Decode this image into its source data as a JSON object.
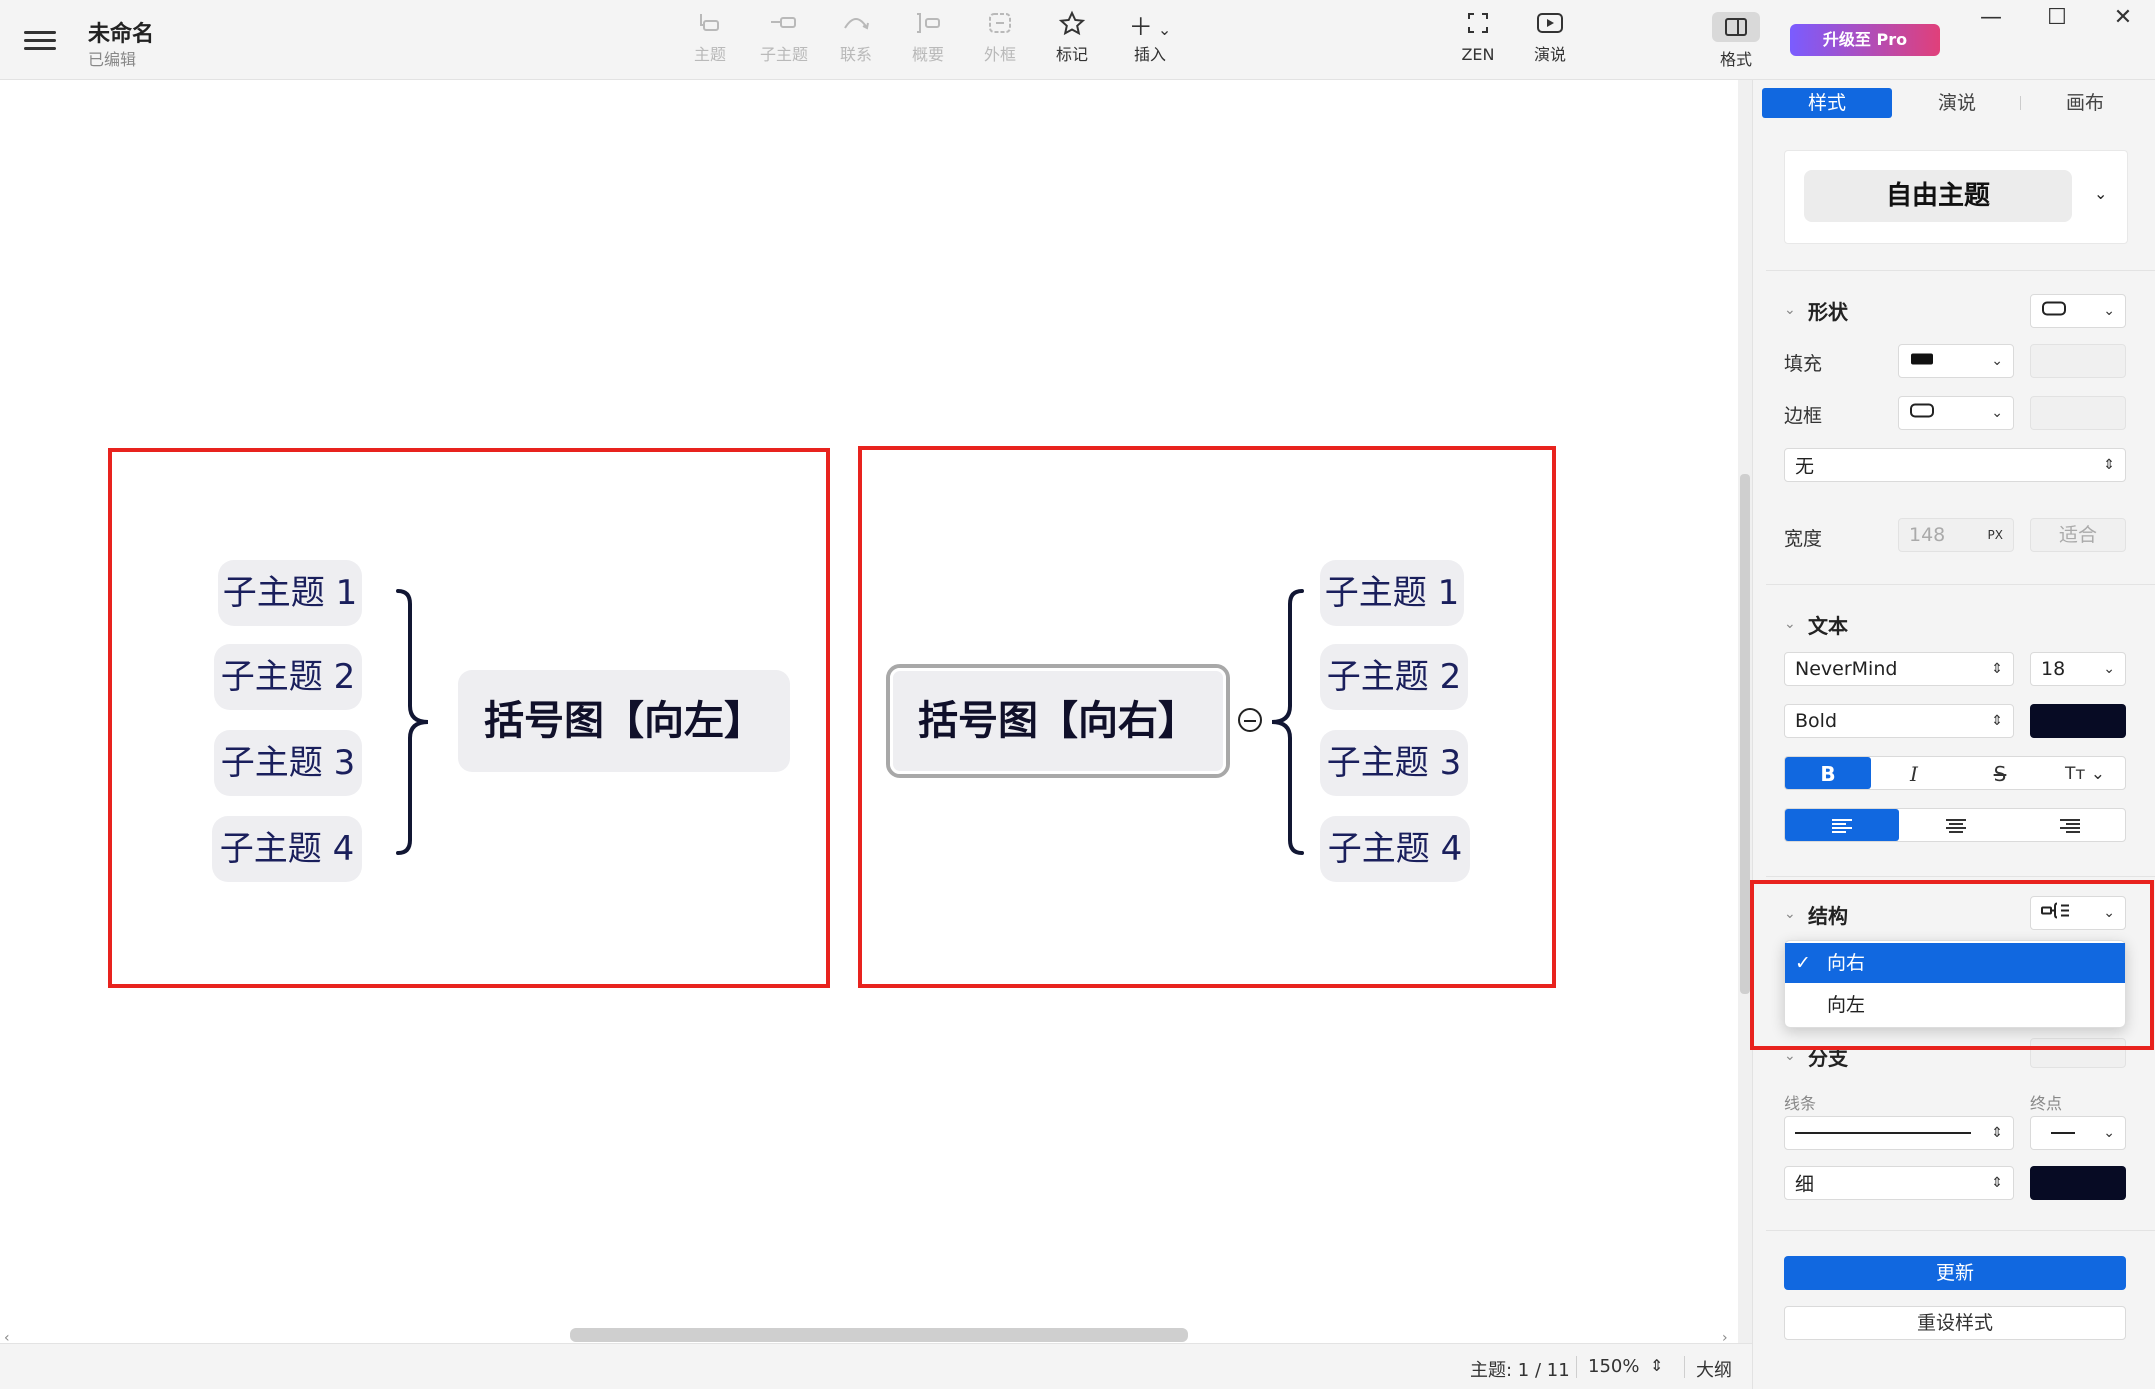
{
  "app": {
    "doc_title": "未命名",
    "doc_status": "已编辑",
    "upgrade_label": "升级至 Pro"
  },
  "toolbar": {
    "items": [
      {
        "label": "主题",
        "icon": "topic-icon",
        "enabled": false
      },
      {
        "label": "子主题",
        "icon": "subtopic-icon",
        "enabled": false
      },
      {
        "label": "联系",
        "icon": "relationship-icon",
        "enabled": false
      },
      {
        "label": "概要",
        "icon": "summary-icon",
        "enabled": false
      },
      {
        "label": "外框",
        "icon": "boundary-icon",
        "enabled": false
      },
      {
        "label": "标记",
        "icon": "star-icon",
        "enabled": true
      },
      {
        "label": "插入",
        "icon": "plus-icon",
        "enabled": true
      }
    ],
    "zen_label": "ZEN",
    "present_label": "演说",
    "format_label": "格式"
  },
  "canvas": {
    "left_map": {
      "central": "括号图【向左】",
      "topics": [
        "子主题 1",
        "子主题 2",
        "子主题 3",
        "子主题 4"
      ]
    },
    "right_map": {
      "central": "括号图【向右】",
      "topics": [
        "子主题 1",
        "子主题 2",
        "子主题 3",
        "子主题 4"
      ]
    }
  },
  "status": {
    "topic_count": "主题: 1 / 11",
    "zoom": "150%",
    "outline_label": "大纲"
  },
  "panel": {
    "tabs": [
      "样式",
      "演说",
      "画布"
    ],
    "theme_name": "自由主题",
    "shape": {
      "title": "形状",
      "fill_label": "填充",
      "border_label": "边框",
      "border_style": "无",
      "width_label": "宽度",
      "width_value": "148",
      "width_unit": "PX",
      "fit_label": "适合"
    },
    "text": {
      "title": "文本",
      "font": "NeverMind",
      "size": "18",
      "weight": "Bold",
      "color": "#070b24"
    },
    "structure": {
      "title": "结构",
      "options": [
        "向右",
        "向左"
      ],
      "selected": "向右"
    },
    "branch": {
      "title": "分支",
      "line_label": "线条",
      "end_label": "终点",
      "thickness": "细",
      "color": "#070b24"
    },
    "update_label": "更新",
    "reset_label": "重设样式"
  },
  "colors": {
    "accent": "#1168e0",
    "highlight": "#e8231e",
    "topic_bg": "#eeeef1",
    "topic_text": "#1a1f5c"
  }
}
